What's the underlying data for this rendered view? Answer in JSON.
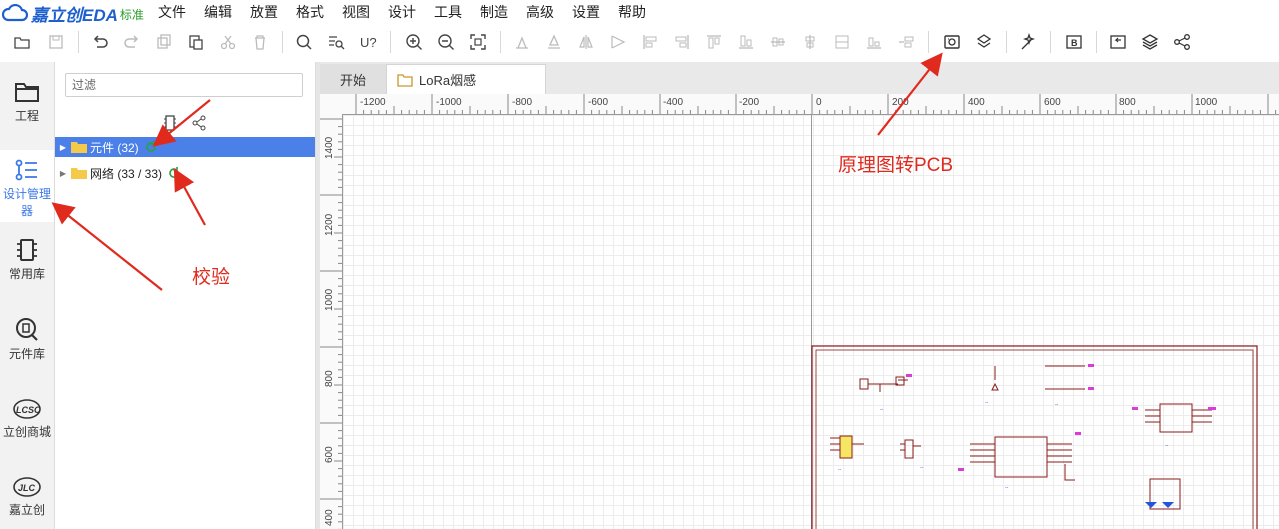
{
  "app": {
    "logo_text": "嘉立创EDA",
    "edition": "标准"
  },
  "menu": [
    "文件",
    "编辑",
    "放置",
    "格式",
    "视图",
    "设计",
    "工具",
    "制造",
    "高级",
    "设置",
    "帮助"
  ],
  "toolbar_icons": [
    "open-folder-icon",
    "save-icon",
    "undo-icon",
    "redo-icon",
    "duplicate-icon",
    "paste-icon",
    "cut-icon",
    "delete-icon",
    "search-icon",
    "find-similar-icon",
    "unknown-symbol-icon",
    "zoom-in-icon",
    "zoom-out-icon",
    "fit-icon",
    "align-top-icon",
    "align-bottom-icon",
    "flip-horizontal-icon",
    "flip-vertical-icon",
    "align-left-icon",
    "align-right-icon",
    "align-top-edge-icon",
    "align-bottom-edge-icon",
    "distribute-horizontal-icon",
    "distribute-vertical-icon",
    "align-center-horizontal-icon",
    "align-center-vertical-icon",
    "align-grid-icon",
    "convert-to-pcb-icon",
    "update-pcb-icon",
    "design-check-icon",
    "bom-icon",
    "import-changes-icon",
    "layers-icon",
    "share-icon"
  ],
  "leftnav": [
    {
      "label": "工程",
      "icon": "folder-icon"
    },
    {
      "label": "设计管理器",
      "icon": "design-manager-icon",
      "active": true
    },
    {
      "label": "常用库",
      "icon": "chip-icon"
    },
    {
      "label": "元件库",
      "icon": "component-search-icon"
    },
    {
      "label": "立创商城",
      "icon": "lcsc-logo-icon"
    },
    {
      "label": "嘉立创",
      "icon": "jlc-logo-icon"
    }
  ],
  "panel": {
    "filter_placeholder": "过滤",
    "tree": [
      {
        "label": "元件 (32)",
        "selected": true
      },
      {
        "label": "网络 (33 / 33)",
        "selected": false
      }
    ]
  },
  "tabs": [
    {
      "label": "开始",
      "active": false
    },
    {
      "label": "LoRa烟感",
      "active": true
    }
  ],
  "ruler": {
    "h_labels": [
      "-1200",
      "-1000",
      "-800",
      "-600",
      "-400",
      "-200",
      "0",
      "200",
      "400",
      "600",
      "800",
      "1000"
    ],
    "v_labels": [
      "1400",
      "1200",
      "1000",
      "800",
      "600",
      "400"
    ]
  },
  "annotations": {
    "convert_pcb": "原理图转PCB",
    "verify": "校验"
  },
  "colors": {
    "accent": "#3b78e7",
    "selected_row": "#4a80e8",
    "annotation": "#e02a1e",
    "schematic_frame": "#8b1a1a"
  }
}
